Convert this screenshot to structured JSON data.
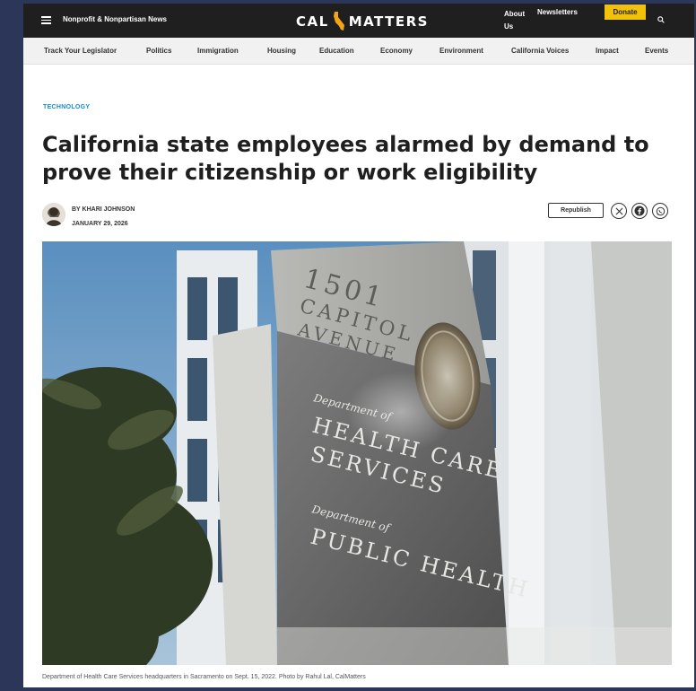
{
  "header": {
    "tagline": "Nonprofit & Nonpartisan News",
    "logo_left": "CAL",
    "logo_right": "MATTERS",
    "about": "About Us",
    "newsletters": "Newsletters",
    "donate": "Donate"
  },
  "nav": {
    "items": [
      "Track Your Legislator",
      "Politics",
      "Immigration",
      "Housing",
      "Education",
      "Economy",
      "Environment",
      "California Voices",
      "Impact",
      "Events"
    ]
  },
  "article": {
    "kicker": "TECHNOLOGY",
    "headline": "California state employees alarmed by demand to prove their citizenship or work eligibility",
    "byline": "BY KHARI JOHNSON",
    "date": "JANUARY 29, 2026",
    "republish": "Republish",
    "photo": {
      "sign_address": [
        "1501",
        "CAPITOL",
        "AVENUE"
      ],
      "sign_dept1_label": "Department of",
      "sign_dept1": [
        "HEALTH CARE",
        "SERVICES"
      ],
      "sign_dept2_label": "Department of",
      "sign_dept2": "PUBLIC HEALTH"
    },
    "caption": "Department of Health Care Services headquarters in Sacramento on Sept. 15, 2022. Photo by Rahul Lal, CalMatters"
  },
  "colors": {
    "page_bg": "#2b3658",
    "topbar": "#1f1f1f",
    "donate": "#f2c20b",
    "kicker": "#1a8cc7",
    "logo_accent": "#f2a51a"
  }
}
